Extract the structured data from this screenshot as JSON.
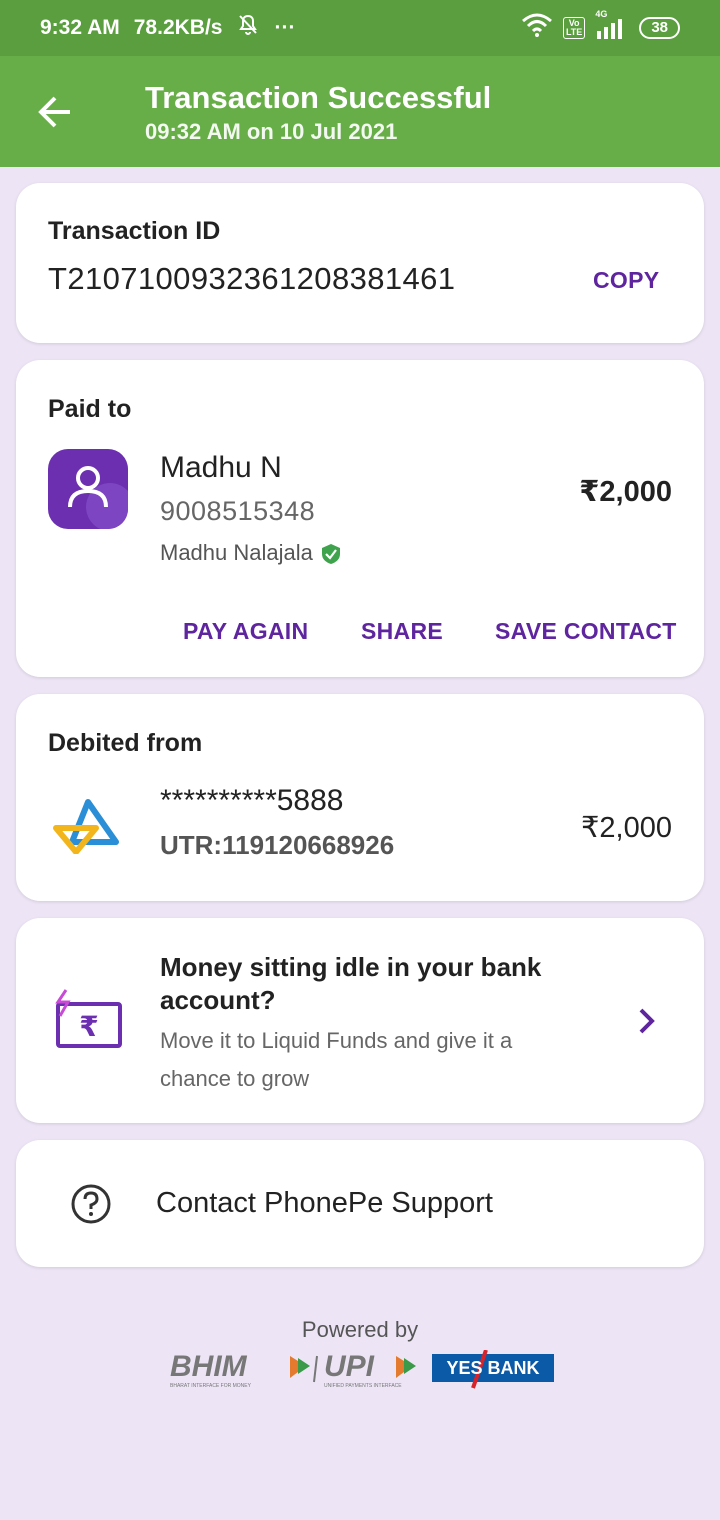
{
  "status_bar": {
    "time": "9:32 AM",
    "net_speed": "78.2KB/s",
    "extra": "···",
    "network": "4G",
    "lte_top": "Vo",
    "lte_bottom": "LTE",
    "battery": "38"
  },
  "header": {
    "title": "Transaction Successful",
    "subtitle": "09:32 AM on 10 Jul 2021"
  },
  "transaction": {
    "label": "Transaction ID",
    "id": "T2107100932361208381461",
    "copy_label": "COPY"
  },
  "paid_to": {
    "label": "Paid to",
    "name": "Madhu N",
    "phone": "9008515348",
    "registered_name": "Madhu Nalajala",
    "amount": "₹2,000",
    "actions": {
      "pay_again": "PAY AGAIN",
      "share": "SHARE",
      "save_contact": "SAVE CONTACT"
    }
  },
  "debited_from": {
    "label": "Debited from",
    "account": "**********5888",
    "utr": "UTR:119120668926",
    "amount": "₹2,000"
  },
  "promo": {
    "title_line1": "Money sitting idle in your bank",
    "title_line2": "account?",
    "desc_line1": "Move it to Liquid Funds and give it a",
    "desc_line2": "chance to grow"
  },
  "support": {
    "label": "Contact PhonePe Support"
  },
  "footer": {
    "powered_by": "Powered by",
    "bhim": "BHIM",
    "bhim_tag": "BHARAT INTERFACE FOR MONEY",
    "upi": "UPI",
    "upi_tag": "UNIFIED PAYMENTS INTERFACE",
    "bank": "YES BANK"
  },
  "colors": {
    "status_bar": "#5a9e3f",
    "app_bar": "#67ad48",
    "accent_purple": "#5f259f",
    "background": "#ede5f5",
    "verified_green": "#3fa34d"
  }
}
